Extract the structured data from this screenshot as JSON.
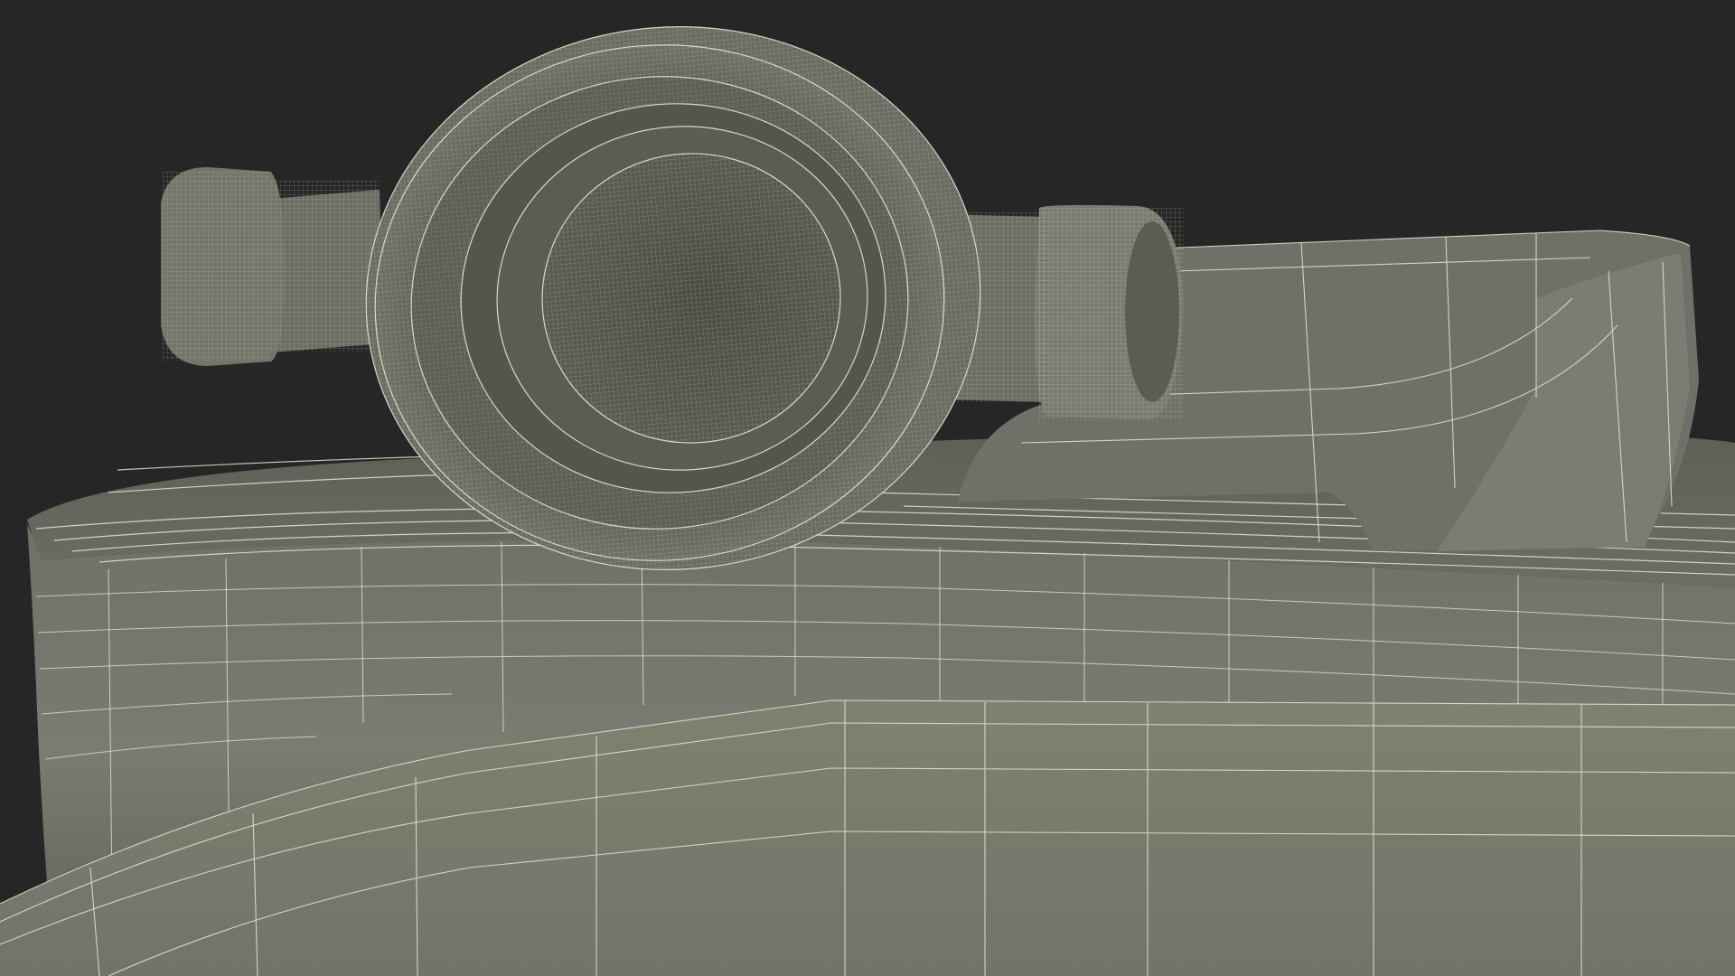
{
  "scene": {
    "subject": "rolled-fire-hose-with-coupling-wireframe",
    "background_color": "#262626",
    "surface_color": "#7a7b70",
    "surface_shadow_color": "#4d4e46",
    "wire_color": "#e6e5d2"
  }
}
